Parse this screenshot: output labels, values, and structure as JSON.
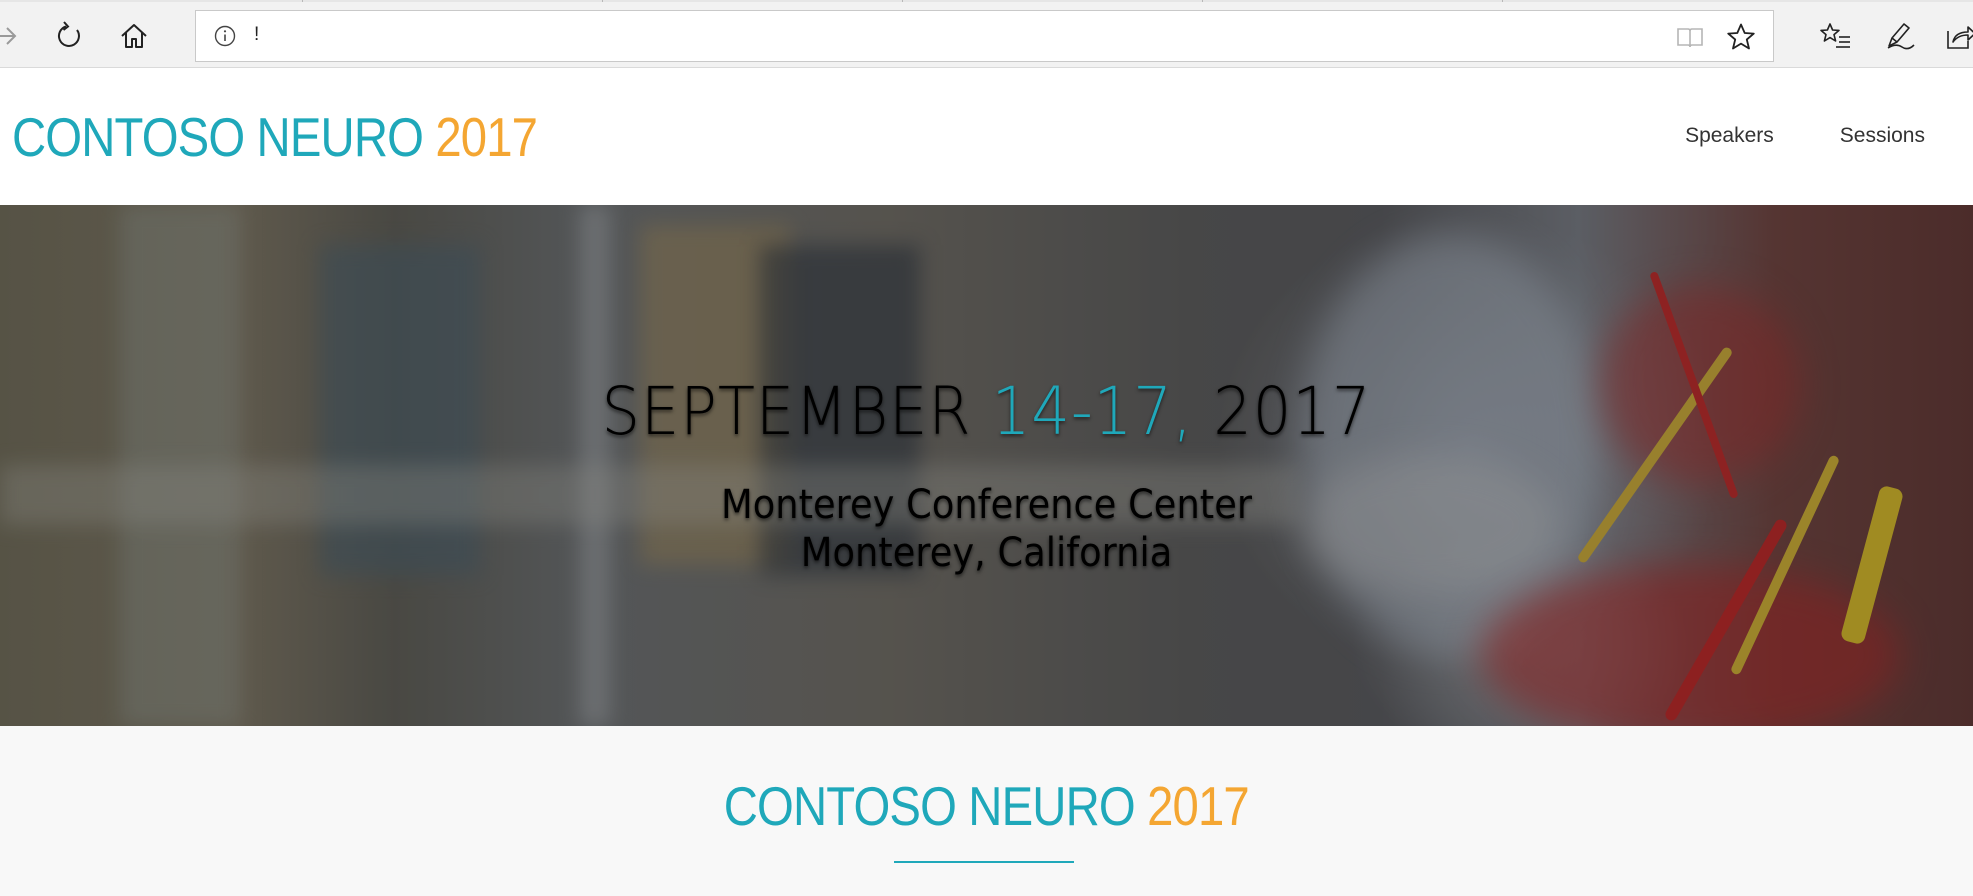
{
  "browser": {
    "address": {
      "url_text": "!"
    },
    "icons": {
      "forward": "arrow-right-icon",
      "refresh": "refresh-icon",
      "home": "home-icon",
      "info": "info-icon",
      "reading_view": "book-icon",
      "favorite": "star-icon",
      "favorites_list": "star-list-icon",
      "notes": "pen-icon",
      "share": "share-icon"
    }
  },
  "site": {
    "logo": {
      "name": "CONTOSO NEURO",
      "year": "2017"
    },
    "nav": [
      {
        "label": "Speakers"
      },
      {
        "label": "Sessions"
      }
    ]
  },
  "hero": {
    "date_month": "SEPTEMBER",
    "date_days": "14-17,",
    "date_year": "2017",
    "venue_line1": "Monterey Conference Center",
    "venue_line2": "Monterey, California"
  },
  "section": {
    "logo": {
      "name": "CONTOSO NEURO",
      "year": "2017"
    }
  },
  "colors": {
    "accent_teal": "#1fa8ba",
    "accent_orange": "#f4a632"
  }
}
